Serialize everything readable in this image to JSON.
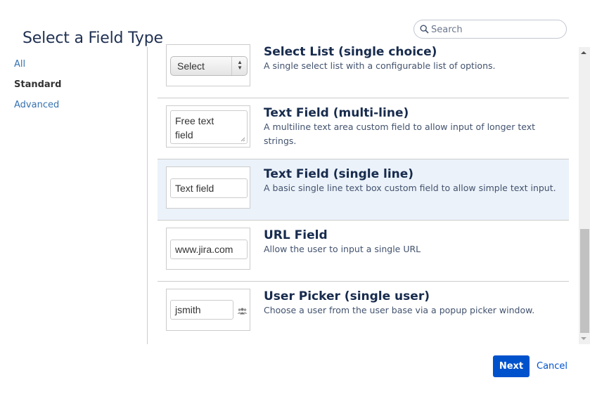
{
  "dialog": {
    "title": "Select a Field Type",
    "search": {
      "placeholder": "Search",
      "value": ""
    }
  },
  "nav": {
    "items": [
      {
        "label": "All",
        "active": false
      },
      {
        "label": "Standard",
        "active": true
      },
      {
        "label": "Advanced",
        "active": false
      }
    ]
  },
  "field_types": [
    {
      "name": "Select List (single choice)",
      "description": "A single select list with a configurable list of options.",
      "preview": {
        "kind": "select",
        "text": "Select"
      },
      "selected": false
    },
    {
      "name": "Text Field (multi-line)",
      "description": "A multiline text area custom field to allow input of longer text strings.",
      "preview": {
        "kind": "textarea",
        "line1": "Free text",
        "line2": "field"
      },
      "selected": false
    },
    {
      "name": "Text Field (single line)",
      "description": "A basic single line text box custom field to allow simple text input.",
      "preview": {
        "kind": "input",
        "text": "Text field"
      },
      "selected": true
    },
    {
      "name": "URL Field",
      "description": "Allow the user to input a single URL",
      "preview": {
        "kind": "input",
        "text": "www.jira.com"
      },
      "selected": false
    },
    {
      "name": "User Picker (single user)",
      "description": "Choose a user from the user base via a popup picker window.",
      "preview": {
        "kind": "userpicker",
        "text": "jsmith",
        "icon": "users-icon"
      },
      "selected": false
    }
  ],
  "footer": {
    "next_label": "Next",
    "cancel_label": "Cancel"
  },
  "colors": {
    "primary": "#0052cc",
    "link": "#3572b0",
    "selected_bg": "#ebf2f9",
    "heading": "#172b4d"
  }
}
